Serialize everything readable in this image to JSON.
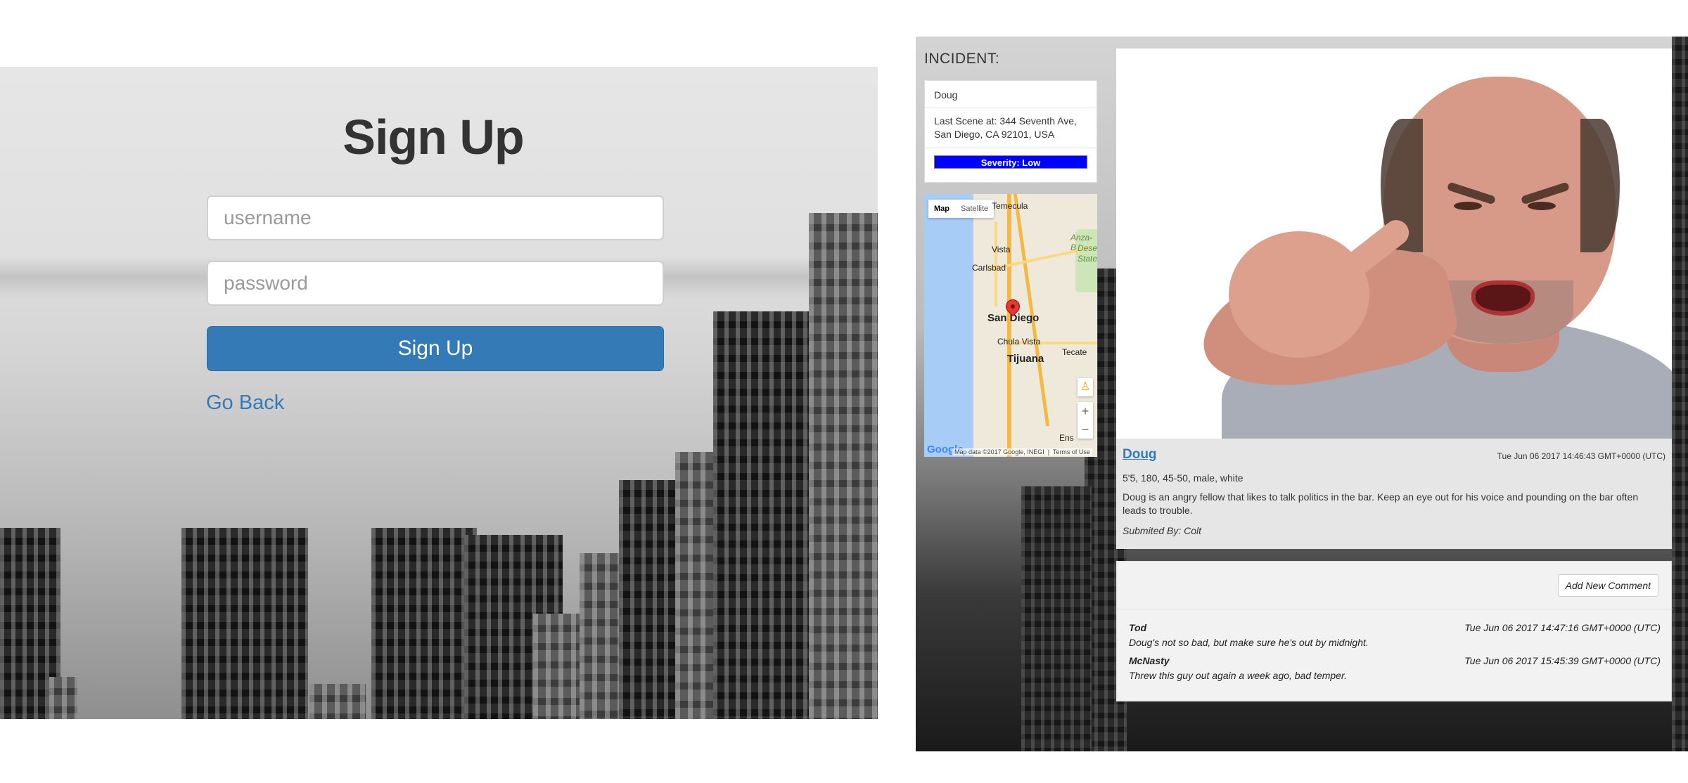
{
  "signup": {
    "title": "Sign Up",
    "username_placeholder": "username",
    "password_placeholder": "password",
    "submit_label": "Sign Up",
    "back_link": "Go Back"
  },
  "incident": {
    "heading": "INCIDENT:",
    "sidebar": {
      "name": "Doug",
      "location": "Last Scene at: 344 Seventh Ave, San Diego, CA 92101, USA",
      "severity": "Severity: Low",
      "severity_color": "#0000ff"
    },
    "map": {
      "tabs": [
        "Map",
        "Satellite"
      ],
      "active_tab": "Map",
      "places": {
        "temecula": "Temecula",
        "vista": "Vista",
        "carlsbad": "Carlsbad",
        "anza": "Anza-B",
        "desert": "Dese",
        "state": "State",
        "san_diego": "San Diego",
        "chula_vista": "Chula Vista",
        "tijuana": "Tijuana",
        "tecate": "Tecate",
        "ens": "Ens"
      },
      "zoom_in": "+",
      "zoom_out": "−",
      "attribution": "Map data ©2017 Google, INEGI",
      "terms": "Terms of Use",
      "logo": "Google"
    },
    "detail": {
      "name": "Doug",
      "timestamp": "Tue Jun 06 2017 14:46:43 GMT+0000 (UTC)",
      "stats": "5'5, 180, 45-50, male, white",
      "description": "Doug is an angry fellow that likes to talk politics in the bar. Keep an eye out for his voice and pounding on the bar often leads to trouble.",
      "submitted_by": "Submited By: Colt"
    },
    "comments": {
      "add_label": "Add New Comment",
      "items": [
        {
          "author": "Tod",
          "time": "Tue Jun 06 2017 14:47:16 GMT+0000 (UTC)",
          "text": "Doug's not so bad, but make sure he's out by midnight."
        },
        {
          "author": "McNasty",
          "time": "Tue Jun 06 2017 15:45:39 GMT+0000 (UTC)",
          "text": "Threw this guy out again a week ago, bad temper."
        }
      ]
    }
  },
  "colors": {
    "accent": "#337ab7",
    "severity_low": "#0000ff"
  }
}
